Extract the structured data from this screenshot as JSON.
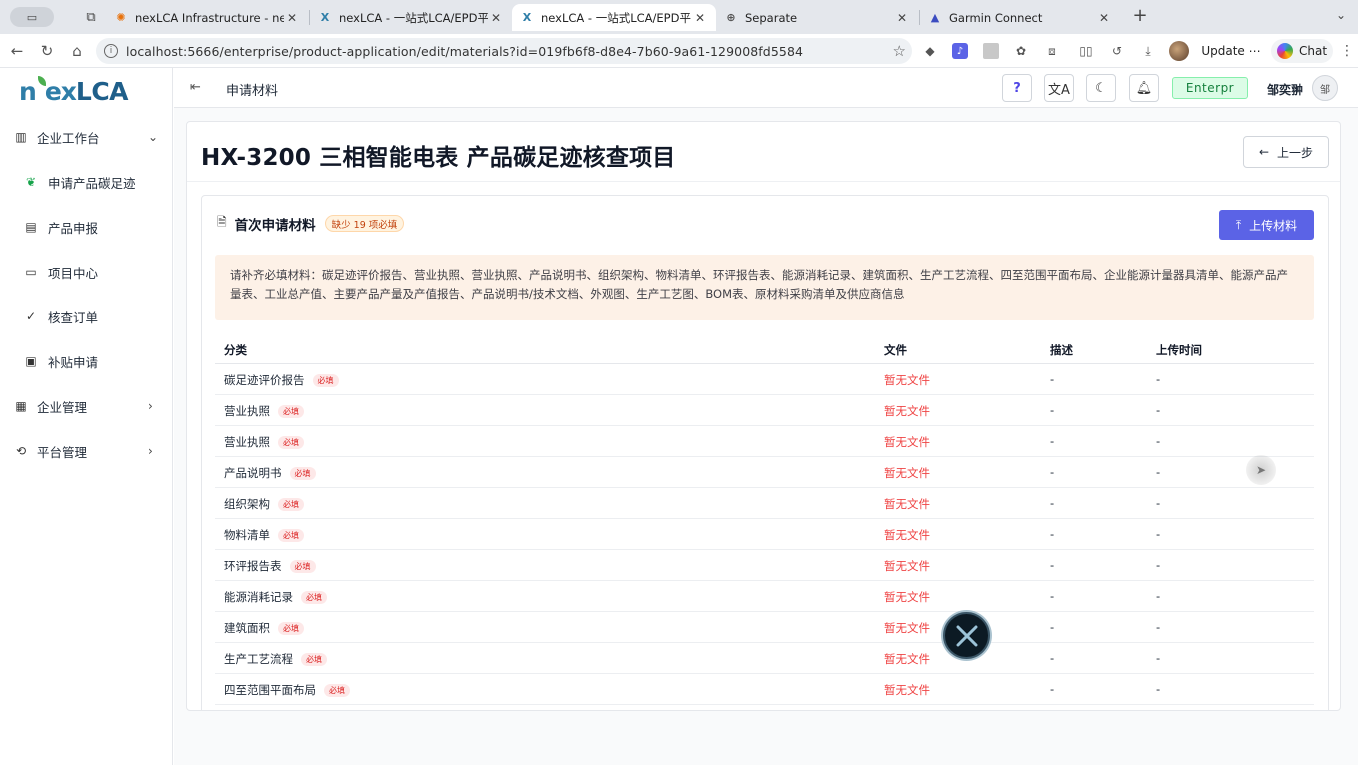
{
  "browser": {
    "tabs": [
      {
        "title": "nexLCA Infrastructure - nexLCA",
        "favicon": "gear-icon",
        "active": false
      },
      {
        "title": "nexLCA - 一站式LCA/EPD平台",
        "favicon": "x-logo-icon",
        "active": false
      },
      {
        "title": "nexLCA - 一站式LCA/EPD平台",
        "favicon": "x-logo-icon",
        "active": true
      },
      {
        "title": "Separate",
        "favicon": "globe-icon",
        "active": false
      },
      {
        "title": "Garmin Connect",
        "favicon": "triangle-logo-icon",
        "active": false
      }
    ],
    "url": "localhost:5666/enterprise/product-application/edit/materials?id=019fb6f8-d8e4-7b60-9a61-129008fd5584",
    "update_label": "Update",
    "chat_label": "Chat"
  },
  "app": {
    "logo_prefix": "n",
    "logo_mid": "ex",
    "logo_suffix": "LCA",
    "brand_color": "#2f7ea8",
    "accent_color": "#5b63e6",
    "sidebar": {
      "items": [
        {
          "label": "企业工作台",
          "icon": "building-icon",
          "level": 0,
          "arrow": "chevron-down-icon"
        },
        {
          "label": "申请产品碳足迹",
          "icon": "leaf-icon",
          "level": 1,
          "active": true
        },
        {
          "label": "产品申报",
          "icon": "clipboard-icon",
          "level": 1
        },
        {
          "label": "项目中心",
          "icon": "briefcase-icon",
          "level": 1
        },
        {
          "label": "核查订单",
          "icon": "check-icon",
          "level": 1
        },
        {
          "label": "补贴申请",
          "icon": "receipt-icon",
          "level": 1
        },
        {
          "label": "企业管理",
          "icon": "office-icon",
          "level": 0,
          "arrow": "chevron-right-icon"
        },
        {
          "label": "平台管理",
          "icon": "sync-icon",
          "level": 0,
          "arrow": "chevron-right-icon"
        }
      ]
    },
    "header": {
      "page_title": "申请材料",
      "env_badge": "Enterpr",
      "user_name": "邹奕翀",
      "avatar_text": "邹"
    },
    "main": {
      "project_title": "HX-3200 三相智能电表 产品碳足迹核查项目",
      "back_label": "上一步",
      "section_title": "首次申请材料",
      "missing_badge": "缺少 19 项必填",
      "upload_label": "上传材料",
      "notice": "请补齐必填材料：碳足迹评价报告、营业执照、营业执照、产品说明书、组织架构、物料清单、环评报告表、能源消耗记录、建筑面积、生产工艺流程、四至范围平面布局、企业能源计量器具清单、能源产品产量表、工业总产值、主要产品产量及产值报告、产品说明书/技术文档、外观图、生产工艺图、BOM表、原材料采购清单及供应商信息",
      "table": {
        "headers": {
          "category": "分类",
          "file": "文件",
          "desc": "描述",
          "time": "上传时间"
        },
        "required_tag": "必填",
        "rows": [
          {
            "category": "碳足迹评价报告",
            "file": "暂无文件",
            "desc": "-",
            "time": "-"
          },
          {
            "category": "营业执照",
            "file": "暂无文件",
            "desc": "-",
            "time": "-"
          },
          {
            "category": "营业执照",
            "file": "暂无文件",
            "desc": "-",
            "time": "-"
          },
          {
            "category": "产品说明书",
            "file": "暂无文件",
            "desc": "-",
            "time": "-"
          },
          {
            "category": "组织架构",
            "file": "暂无文件",
            "desc": "-",
            "time": "-"
          },
          {
            "category": "物料清单",
            "file": "暂无文件",
            "desc": "-",
            "time": "-"
          },
          {
            "category": "环评报告表",
            "file": "暂无文件",
            "desc": "-",
            "time": "-"
          },
          {
            "category": "能源消耗记录",
            "file": "暂无文件",
            "desc": "-",
            "time": "-"
          },
          {
            "category": "建筑面积",
            "file": "暂无文件",
            "desc": "-",
            "time": "-"
          },
          {
            "category": "生产工艺流程",
            "file": "暂无文件",
            "desc": "-",
            "time": "-"
          },
          {
            "category": "四至范围平面布局",
            "file": "暂无文件",
            "desc": "-",
            "time": "-"
          }
        ]
      }
    }
  }
}
